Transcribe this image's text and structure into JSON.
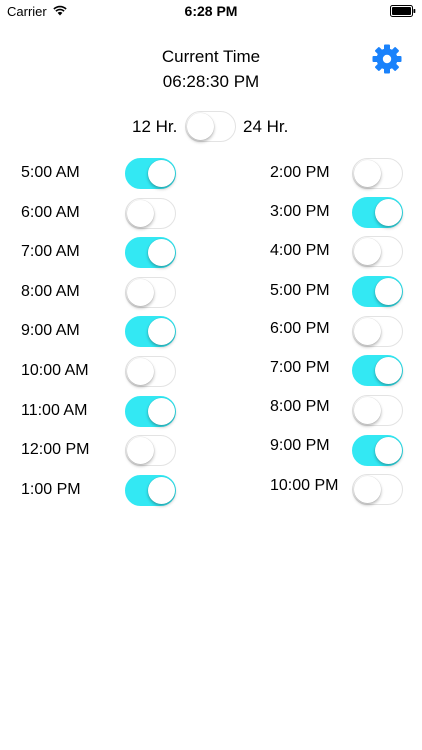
{
  "status_bar": {
    "carrier": "Carrier",
    "time": "6:28 PM",
    "wifi_icon": "wifi-icon",
    "battery_icon": "battery-full-icon"
  },
  "header": {
    "title": "Current Time",
    "current_time": "06:28:30 PM",
    "settings_icon": "gear-icon",
    "accent_color": "#1a82fb"
  },
  "format_toggle": {
    "left_label": "12 Hr.",
    "right_label": "24 Hr.",
    "is_24h": false
  },
  "toggle_on_color": "#33e8f3",
  "left_column": [
    {
      "label": "5:00 AM",
      "on": true
    },
    {
      "label": "6:00 AM",
      "on": false
    },
    {
      "label": "7:00 AM",
      "on": true
    },
    {
      "label": "8:00 AM",
      "on": false
    },
    {
      "label": "9:00 AM",
      "on": true
    },
    {
      "label": "10:00 AM",
      "on": false
    },
    {
      "label": "11:00 AM",
      "on": true
    },
    {
      "label": "12:00 PM",
      "on": false
    },
    {
      "label": "1:00 PM",
      "on": true
    }
  ],
  "right_column": [
    {
      "label": "2:00 PM",
      "on": false
    },
    {
      "label": "3:00 PM",
      "on": true
    },
    {
      "label": "4:00 PM",
      "on": false
    },
    {
      "label": "5:00 PM",
      "on": true
    },
    {
      "label": "6:00 PM",
      "on": false
    },
    {
      "label": "7:00 PM",
      "on": true
    },
    {
      "label": "8:00 PM",
      "on": false
    },
    {
      "label": "9:00 PM",
      "on": true
    },
    {
      "label": "10:00 PM",
      "on": false
    }
  ]
}
